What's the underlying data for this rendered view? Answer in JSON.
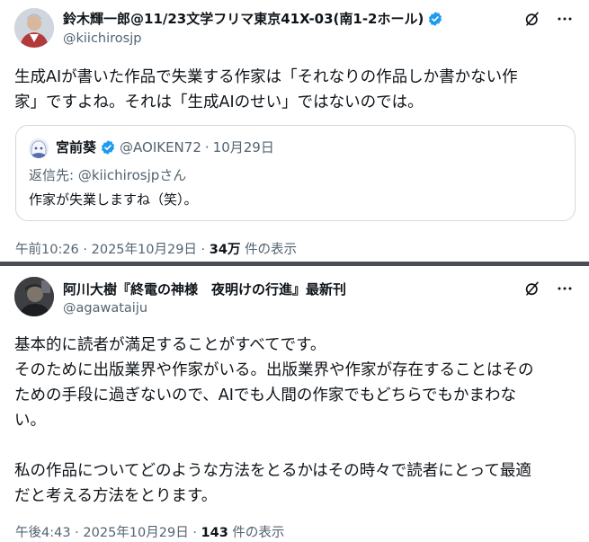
{
  "post1": {
    "display_name": "鈴木輝一郎@11/23文学フリマ東京41X-03(南1-2ホール)",
    "handle": "@kiichirosjp",
    "verified": true,
    "text": "生成AIが書いた作品で失業する作家は「それなりの作品しか書かない作\n家」ですよね。それは「生成AIのせい」ではないのでは。",
    "quote": {
      "display_name": "宮前葵",
      "verified": true,
      "handle": "@AOIKEN72",
      "separator": "·",
      "date": "10月29日",
      "reply_to": "返信先: @kiichirosjpさん",
      "text": "作家が失業しますね（笑）。"
    },
    "time": "午前10:26",
    "date": "2025年10月29日",
    "dot": "·",
    "views": "34万",
    "views_label": "件の表示"
  },
  "post2": {
    "display_name": "阿川大樹『終電の神様　夜明けの行進』最新刊",
    "handle": "@agawataiju",
    "verified": false,
    "text": "基本的に読者が満足することがすべてです。\nそのために出版業界や作家がいる。出版業界や作家が存在することはその\nための手段に過ぎないので、AIでも人間の作家でもどちらでもかまわな\nい。\n\n私の作品についてどのような方法をとるかはその時々で読者にとって最適\nだと考える方法をとります。",
    "time": "午後4:43",
    "date": "2025年10月29日",
    "dot": "·",
    "views": "143",
    "views_label": "件の表示"
  },
  "icons": {
    "verified": "verified-badge-icon",
    "grok": "grok-icon",
    "more": "more-options-icon"
  },
  "colors": {
    "text_primary": "#0f1419",
    "text_secondary": "#536471",
    "verified_blue": "#1d9bf0",
    "border": "#cfd9de",
    "separator": "#4b4f54"
  }
}
